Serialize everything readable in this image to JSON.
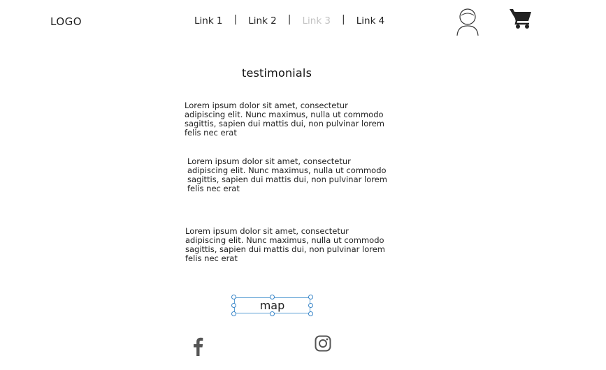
{
  "header": {
    "logo": "LOGO",
    "nav": [
      {
        "label": "Link 1"
      },
      {
        "label": "Link 2"
      },
      {
        "label": "Link 3"
      },
      {
        "label": "Link 4"
      }
    ],
    "separator": "|",
    "user_icon": "user-avatar-icon",
    "cart_icon": "shopping-cart-icon"
  },
  "main": {
    "title": "testimonials",
    "testimonials": [
      "Lorem ipsum dolor sit amet, consectetur adipiscing elit. Nunc maximus, nulla ut commodo sagittis, sapien dui mattis dui, non pulvinar lorem felis nec erat",
      "Lorem ipsum dolor sit amet, consectetur adipiscing elit. Nunc maximus, nulla ut commodo sagittis, sapien dui mattis dui, non pulvinar lorem felis nec erat",
      "Lorem ipsum dolor sit amet, consectetur adipiscing elit. Nunc maximus, nulla ut commodo sagittis, sapien dui mattis dui, non pulvinar lorem felis nec erat"
    ],
    "map_label": "map"
  },
  "footer": {
    "social": [
      "facebook-icon",
      "instagram-icon"
    ]
  },
  "colors": {
    "text": "#222222",
    "muted_link": "#c2c2c2",
    "selection": "#5a9fd4"
  }
}
